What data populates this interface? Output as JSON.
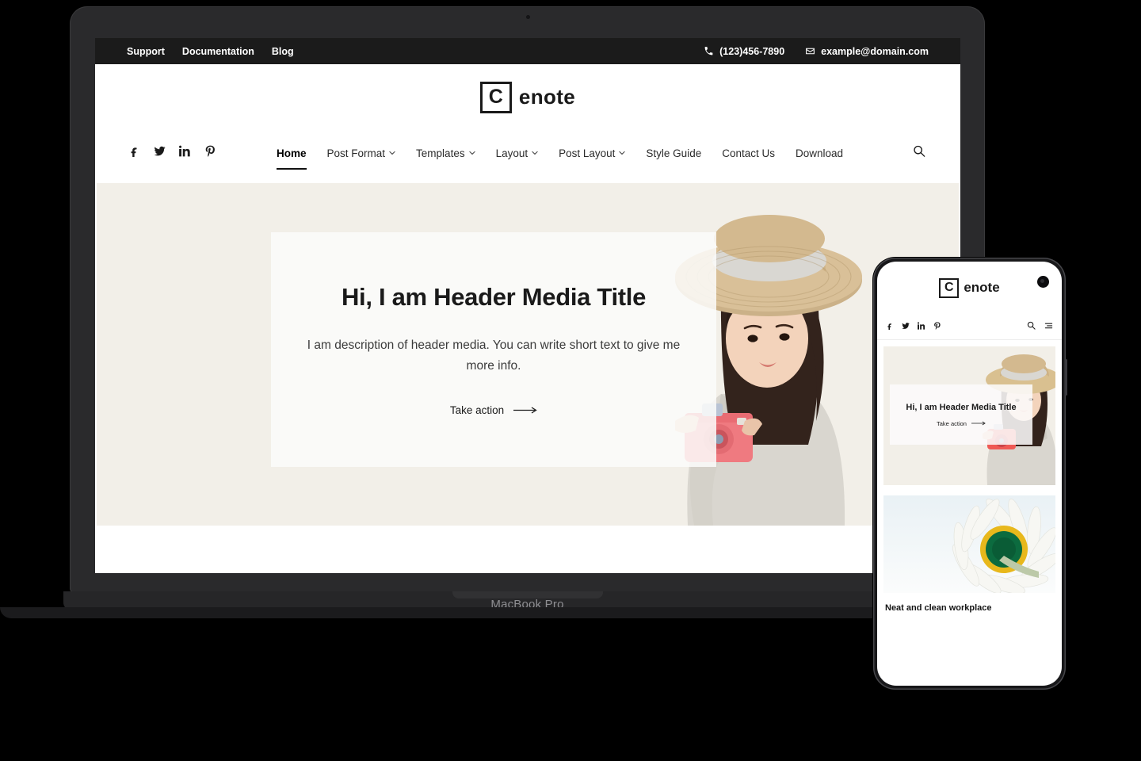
{
  "device_laptop": {
    "label": "MacBook Pro",
    "frame_color": "#2a2a2c"
  },
  "device_phone": {
    "frame_color": "#18181a"
  },
  "site": {
    "topbar": {
      "links": [
        {
          "label": "Support"
        },
        {
          "label": "Documentation"
        },
        {
          "label": "Blog"
        }
      ],
      "phone": "(123)456-7890",
      "email": "example@domain.com",
      "background": "#1b1b1b"
    },
    "logo": {
      "mark": "C",
      "word": "enote"
    },
    "social": [
      {
        "name": "facebook"
      },
      {
        "name": "twitter"
      },
      {
        "name": "linkedin"
      },
      {
        "name": "pinterest"
      }
    ],
    "menu": [
      {
        "label": "Home",
        "active": true,
        "caret": false
      },
      {
        "label": "Post Format",
        "active": false,
        "caret": true
      },
      {
        "label": "Templates",
        "active": false,
        "caret": true
      },
      {
        "label": "Layout",
        "active": false,
        "caret": true
      },
      {
        "label": "Post Layout",
        "active": false,
        "caret": true
      },
      {
        "label": "Style Guide",
        "active": false,
        "caret": false
      },
      {
        "label": "Contact Us",
        "active": false,
        "caret": false
      },
      {
        "label": "Download",
        "active": false,
        "caret": false
      }
    ],
    "hero": {
      "title": "Hi, I am Header Media Title",
      "description": "I am description of header media. You can write short text to give me more info.",
      "cta": "Take action",
      "background": "#f2efe8",
      "card_background": "#fcfbfa"
    }
  },
  "phone_site": {
    "logo": {
      "mark": "C",
      "word": "enote"
    },
    "hero": {
      "title": "Hi, I am Header Media Title",
      "cta": "Take action"
    },
    "post_card": {
      "title": "Neat and clean workplace"
    }
  }
}
